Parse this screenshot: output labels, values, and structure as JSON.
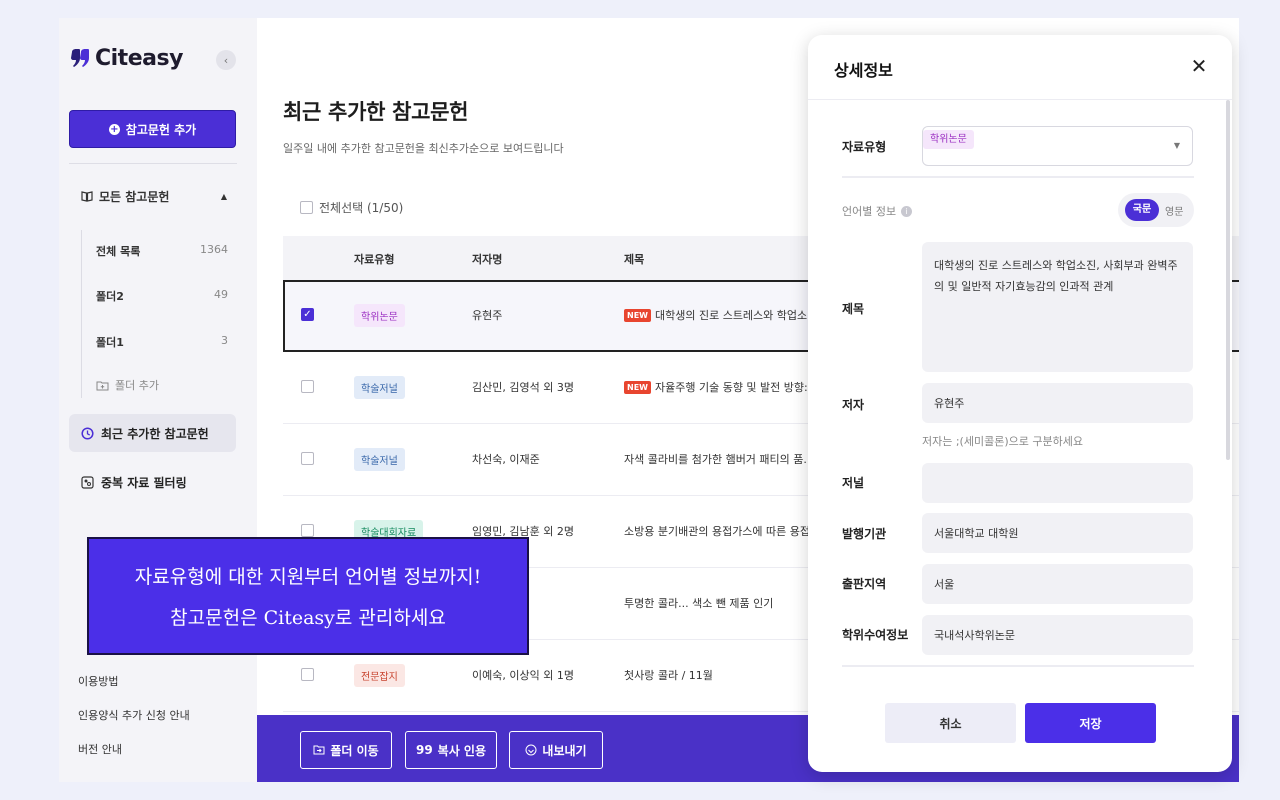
{
  "app": {
    "logo_text": "Citeasy",
    "collapse_icon": "chevron-left-icon"
  },
  "sidebar": {
    "add_reference_label": "참고문헌 추가",
    "all_references_label": "모든 참고문헌",
    "folders": [
      {
        "label": "전체 목록",
        "count": "1364"
      },
      {
        "label": "폴더2",
        "count": "49"
      },
      {
        "label": "폴더1",
        "count": "3"
      }
    ],
    "add_folder_label": "폴더 추가",
    "recent_label": "최근 추가한 참고문헌",
    "duplicate_filter_label": "중복 자료 필터링",
    "links": [
      "이용방법",
      "인용양식 추가 신청 안내",
      "버전 안내"
    ]
  },
  "main": {
    "title": "최근 추가한 참고문헌",
    "subtitle": "일주일 내에 추가한 참고문헌을 최신추가순으로 보여드립니다",
    "select_all_label": "전체선택 (1/50)",
    "columns": [
      "자료유형",
      "저자명",
      "제목"
    ],
    "new_tag": "NEW",
    "rows": [
      {
        "type": "학위논문",
        "author": "유현주",
        "title": "대학생의 진로 스트레스와 학업소...",
        "is_new": true,
        "checked": true
      },
      {
        "type": "학술저널",
        "author": "김산민, 김영석 외 3명",
        "title": "자율주행 기술 동향 및 발전 방향:",
        "is_new": true,
        "checked": false
      },
      {
        "type": "학술저널",
        "author": "차선숙, 이재준",
        "title": "자색 콜라비를 첨가한 햄버거 패티의 품...",
        "is_new": false,
        "checked": false
      },
      {
        "type": "학술대회자료",
        "author": "임영민, 김남훈 외 2명",
        "title": "소방용 분기배관의 용접가스에 따른 용접",
        "is_new": false,
        "checked": false
      },
      {
        "type": "",
        "author": "",
        "title": "투명한 콜라... 색소 뺀 제품 인기",
        "is_new": false,
        "checked": false
      },
      {
        "type": "전문잡지",
        "author": "이예숙, 이상익 외 1명",
        "title": "첫사랑 콜라 / 11월",
        "is_new": false,
        "checked": false
      }
    ],
    "bottom_bar": {
      "move_folder": "폴더 이동",
      "copy_cite": "복사 인용",
      "export": "내보내기"
    }
  },
  "promo": {
    "line1": "자료유형에 대한 지원부터 언어별 정보까지!",
    "line2": "참고문헌은 Citeasy로 관리하세요"
  },
  "modal": {
    "title": "상세정보",
    "close_icon": "close-icon",
    "type_label": "자료유형",
    "type_value": "학위논문",
    "lang_label": "언어별 정보",
    "lang_on": "국문",
    "lang_off": "영문",
    "title_label": "제목",
    "title_value": "대학생의 진로 스트레스와 학업소진, 사회부과 완벽주의 및 일반적 자기효능감의 인과적 관계",
    "author_label": "저자",
    "author_value": "유현주",
    "author_hint": "저자는 ;(세미콜론)으로 구분하세요",
    "journal_label": "저널",
    "journal_value": "",
    "publisher_label": "발행기관",
    "publisher_value": "서울대학교 대학원",
    "location_label": "출판지역",
    "location_value": "서울",
    "degree_label": "학위수여정보",
    "degree_value": "국내석사학위논문",
    "cancel_label": "취소",
    "save_label": "저장"
  },
  "colors": {
    "accent": "#4b2fd6",
    "promo_bg": "#4b2fe8",
    "new_tag": "#e8452f"
  }
}
